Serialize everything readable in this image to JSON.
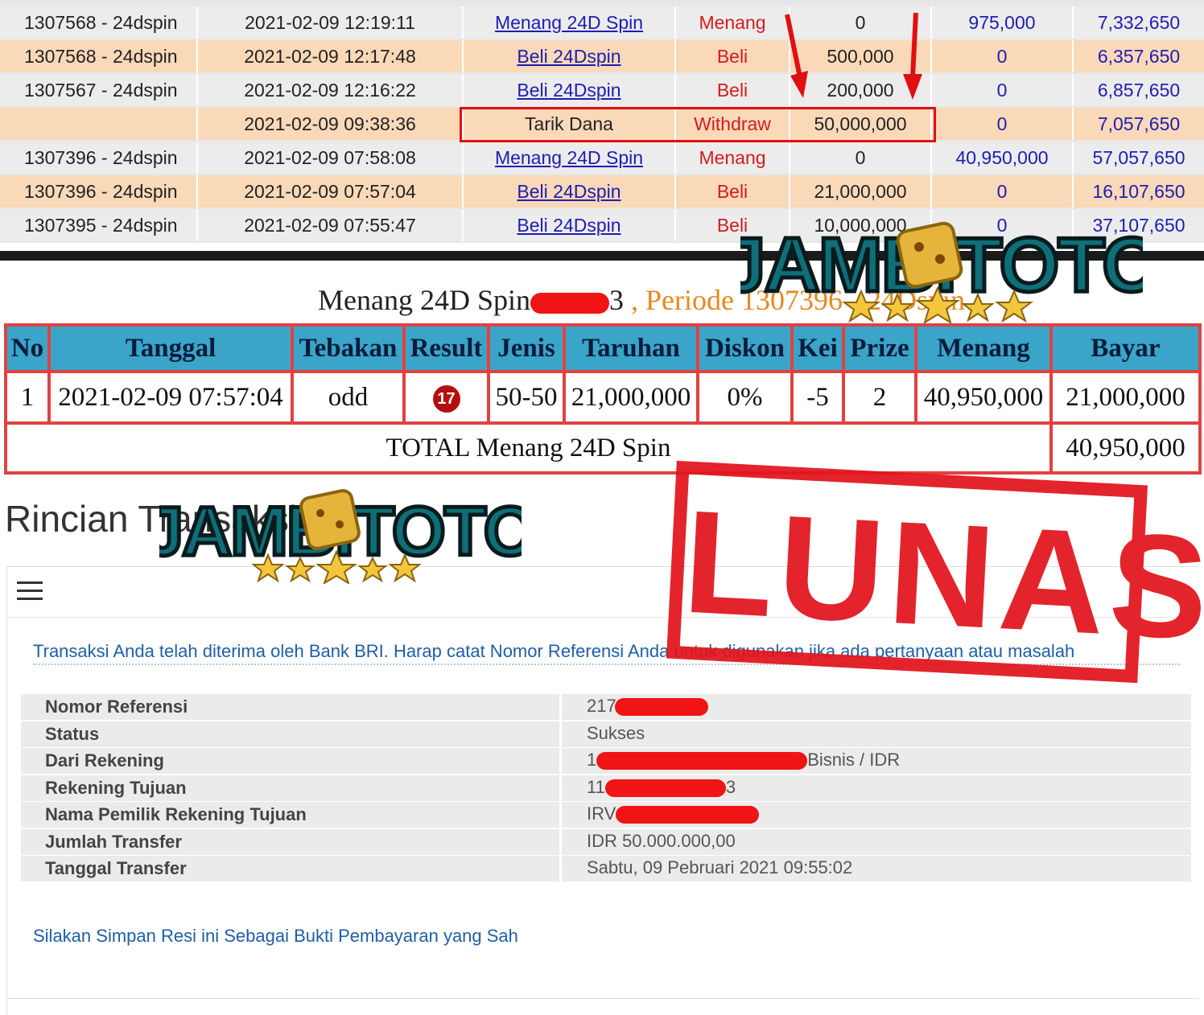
{
  "history": {
    "rows": [
      {
        "periode": "1307568 - 24dspin",
        "tanggal": "2021-02-09 12:19:11",
        "keterangan": "Menang 24D Spin",
        "tipe": "Menang",
        "debit": "0",
        "kredit": "975,000",
        "saldo": "7,332,650"
      },
      {
        "periode": "1307568 - 24dspin",
        "tanggal": "2021-02-09 12:17:48",
        "keterangan": "Beli 24Dspin",
        "tipe": "Beli",
        "debit": "500,000",
        "kredit": "0",
        "saldo": "6,357,650"
      },
      {
        "periode": "1307567 - 24dspin",
        "tanggal": "2021-02-09 12:16:22",
        "keterangan": "Beli 24Dspin",
        "tipe": "Beli",
        "debit": "200,000",
        "kredit": "0",
        "saldo": "6,857,650"
      },
      {
        "periode": "",
        "tanggal": "2021-02-09 09:38:36",
        "keterangan": "Tarik Dana",
        "tipe": "Withdraw",
        "debit": "50,000,000",
        "kredit": "0",
        "saldo": "7,057,650"
      },
      {
        "periode": "1307396 - 24dspin",
        "tanggal": "2021-02-09 07:58:08",
        "keterangan": "Menang 24D Spin",
        "tipe": "Menang",
        "debit": "0",
        "kredit": "40,950,000",
        "saldo": "57,057,650"
      },
      {
        "periode": "1307396 - 24dspin",
        "tanggal": "2021-02-09 07:57:04",
        "keterangan": "Beli 24Dspin",
        "tipe": "Beli",
        "debit": "21,000,000",
        "kredit": "0",
        "saldo": "16,107,650"
      },
      {
        "periode": "1307395 - 24dspin",
        "tanggal": "2021-02-09 07:55:47",
        "keterangan": "Beli 24Dspin",
        "tipe": "Beli",
        "debit": "10,000,000",
        "kredit": "0",
        "saldo": "37,107,650"
      }
    ]
  },
  "logo": {
    "text": "JAMBITOTO"
  },
  "bet": {
    "title": "Menang 24D Spin",
    "title_suffix": "3",
    "periode": ", Periode 1307396 - 24Dspin",
    "headers": [
      "No",
      "Tanggal",
      "Tebakan",
      "Result",
      "Jenis",
      "Taruhan",
      "Diskon",
      "Kei",
      "Prize",
      "Menang",
      "Bayar"
    ],
    "row": {
      "no": "1",
      "tanggal": "2021-02-09 07:57:04",
      "tebakan": "odd",
      "result": "17",
      "jenis": "50-50",
      "taruhan": "21,000,000",
      "diskon": "0%",
      "kei": "-5",
      "prize": "2",
      "menang": "40,950,000",
      "bayar": "21,000,000"
    },
    "total_label": "TOTAL  Menang 24D Spin",
    "total_value": "40,950,000"
  },
  "receipt": {
    "heading": "Rincian Transaksi",
    "notice": "Transaksi Anda telah diterima oleh Bank BRI. Harap catat Nomor Referensi Anda untuk digunakan jika ada pertanyaan atau masalah",
    "details": [
      {
        "label": "Nomor Referensi",
        "value": "217"
      },
      {
        "label": "Status",
        "value": "Sukses"
      },
      {
        "label": "Dari Rekening",
        "value": "1",
        "value_suffix": "Bisnis / IDR"
      },
      {
        "label": "Rekening Tujuan",
        "value": "11",
        "value_suffix": "3"
      },
      {
        "label": "Nama Pemilik Rekening Tujuan",
        "value": "IRV"
      },
      {
        "label": "Jumlah Transfer",
        "value": "IDR 50.000.000,00"
      },
      {
        "label": "Tanggal Transfer",
        "value": "Sabtu, 09 Pebruari 2021 09:55:02"
      }
    ],
    "footer": "Silakan Simpan Resi ini Sebagai Bukti Pembayaran yang Sah"
  },
  "stamp": {
    "text": "LUNAS"
  },
  "colors": {
    "stamp": "#e1141d",
    "header_blue": "#3aa4c9",
    "row_peach": "#fad9b9",
    "link": "#1d1db3"
  }
}
